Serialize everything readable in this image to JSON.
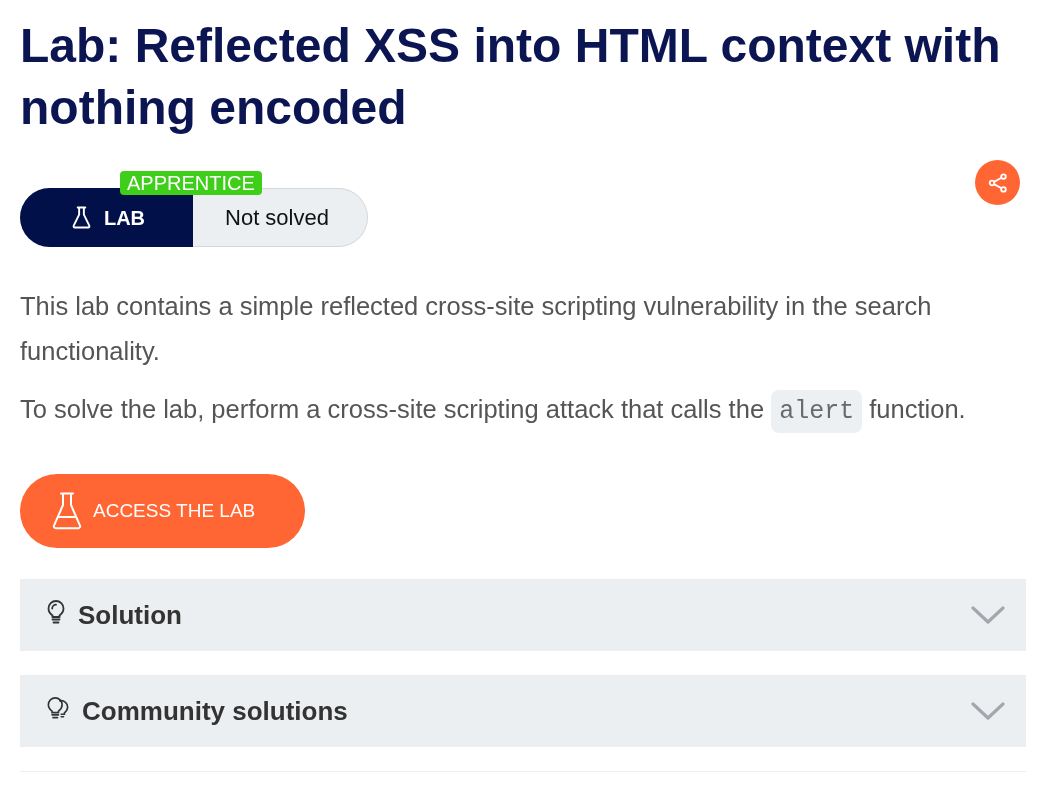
{
  "title": "Lab: Reflected XSS into HTML context with nothing encoded",
  "lab": {
    "type": "LAB",
    "level": "APPRENTICE",
    "status": "Not solved"
  },
  "description": [
    [
      {
        "kind": "text",
        "text": "This lab contains a simple reflected cross-site scripting vulnerability in the search functionality."
      }
    ],
    [
      {
        "kind": "text",
        "text": "To solve the lab, perform a cross-site scripting attack that calls the "
      },
      {
        "kind": "code",
        "text": "alert"
      },
      {
        "kind": "text",
        "text": " function."
      }
    ]
  ],
  "access_button": {
    "label": "ACCESS THE LAB"
  },
  "sections": [
    {
      "kind": "solution",
      "title": "Solution",
      "expanded": false
    },
    {
      "kind": "community",
      "title": "Community solutions",
      "expanded": false
    }
  ]
}
